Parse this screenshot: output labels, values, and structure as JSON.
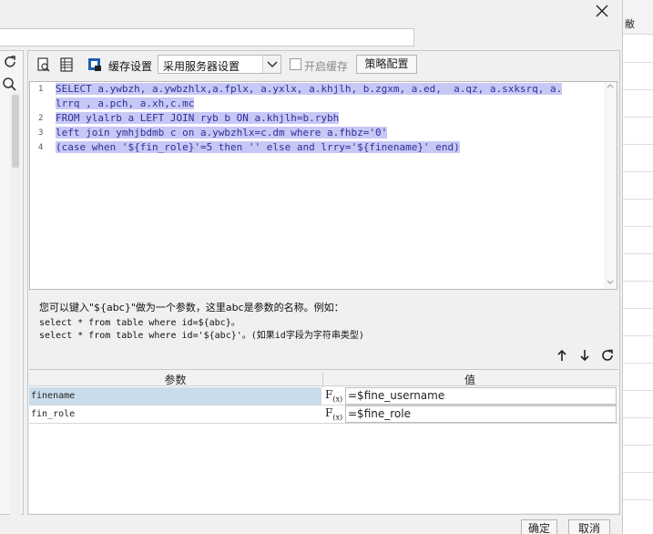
{
  "background_window": {
    "column_header_fragment": "敝"
  },
  "toolbar": {
    "cache_settings_label": "缓存设置",
    "server_setting_select": "采用服务器设置",
    "enable_cache_label": "开启缓存",
    "strategy_button": "策略配置"
  },
  "sql_editor": {
    "lines": [
      {
        "number": "1",
        "text": "SELECT a.ywbzh, a.ywbzhlx,a.fplx, a.yxlx, a.khjlh, b.zgxm, a.ed,  a.qz, a.sxksrq, a."
      },
      {
        "number": "",
        "text": "lrrq , a.pch, a.xh,c.mc"
      },
      {
        "number": "2",
        "text": "FROM ylalrb a LEFT JOIN ryb b ON a.khjlh=b.rybh"
      },
      {
        "number": "3",
        "text": "left join ymhjbdmb c on a.ywbzhlx=c.dm where a.fhbz='0'"
      },
      {
        "number": "4",
        "text": "(case when '${fin_role}'=5 then '' else and lrry='${finename}' end)"
      }
    ]
  },
  "hint": {
    "line1": "您可以键入\"${abc}\"做为一个参数，这里abc是参数的名称。例如：",
    "line2": "select * from table where id=${abc}。",
    "line3": "select * from table where id='${abc}'。(如果id字段为字符串类型)"
  },
  "params_table": {
    "header_param": "参数",
    "header_value": "值",
    "fx_label": "F",
    "fx_sub": "(x)",
    "rows": [
      {
        "name": "finename",
        "value": "=$fine_username",
        "selected": true
      },
      {
        "name": "fin_role",
        "value": "=$fine_role",
        "selected": false
      }
    ]
  },
  "footer": {
    "ok_button": "确定",
    "cancel_button": "取消"
  },
  "colors": {
    "selection_bg": "#c7c8f5",
    "selected_row_bg": "#c9dcec",
    "dialog_bg": "#f0f0f0"
  },
  "icons": [
    "close-icon",
    "refresh-icon",
    "search-icon",
    "preview-icon",
    "table-icon",
    "cache-settings-icon",
    "chevron-down-icon",
    "arrow-up-icon",
    "arrow-down-icon",
    "refresh-params-icon"
  ]
}
